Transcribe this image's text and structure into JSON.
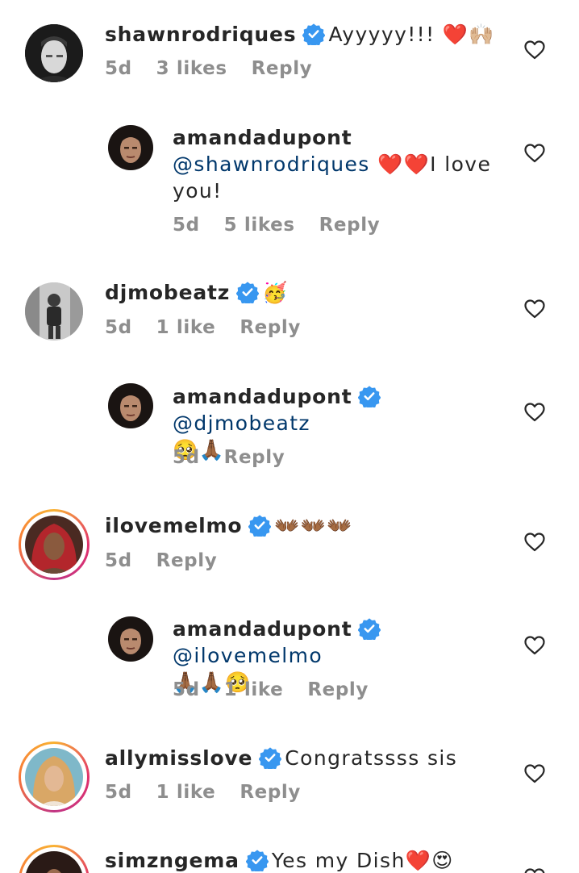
{
  "comments": [
    {
      "username": "shawnrodriques",
      "text": "Ayyyyy!!! ❤️🙌🏼",
      "time": "5d",
      "likes": "3 likes",
      "reply": "Reply",
      "verified": true
    },
    {
      "username": "amandadupont",
      "mention": "@shawnrodriques",
      "text": "❤️❤️I love you!",
      "time": "5d",
      "likes": "5 likes",
      "reply": "Reply",
      "verified": false
    },
    {
      "username": "djmobeatz",
      "text": "🥳",
      "time": "5d",
      "likes": "1 like",
      "reply": "Reply",
      "verified": true
    },
    {
      "username": "amandadupont",
      "mention": "@djmobeatz",
      "text": "🥺🙏🏾",
      "time": "5d",
      "likes": "",
      "reply": "Reply",
      "verified": true
    },
    {
      "username": "ilovemelmo",
      "text": "👐🏾👐🏾👐🏾",
      "time": "5d",
      "likes": "",
      "reply": "Reply",
      "verified": true
    },
    {
      "username": "amandadupont",
      "mention": "@ilovemelmo",
      "text": "🙏🏾🙏🏾🥺",
      "time": "5d",
      "likes": "1 like",
      "reply": "Reply",
      "verified": true
    },
    {
      "username": "allymisslove",
      "text": "Congratssss sis",
      "time": "5d",
      "likes": "1 like",
      "reply": "Reply",
      "verified": true
    },
    {
      "username": "simzngema",
      "text": "Yes my Dish❤️😍",
      "time": "",
      "likes": "",
      "reply": "",
      "verified": true
    }
  ],
  "colors": {
    "verified": "#3897f0",
    "mention": "#00376b",
    "meta": "#8e8e8e",
    "heart": "#e0242e"
  },
  "icons": {
    "like": "heart-outline-icon",
    "verified": "verified-badge-icon"
  }
}
